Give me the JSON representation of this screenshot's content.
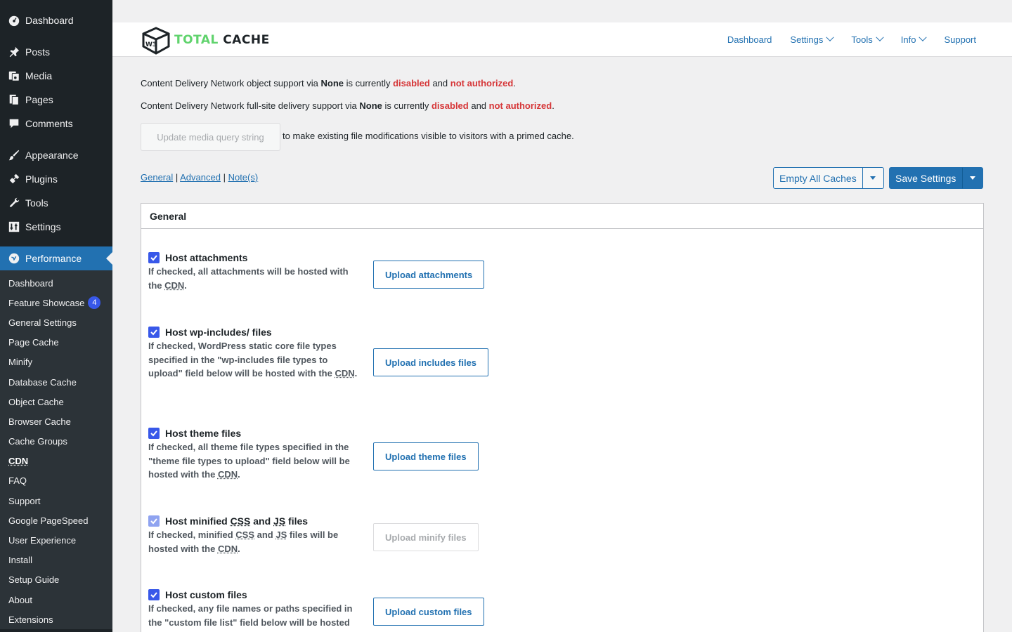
{
  "sidebar": {
    "top_items": [
      {
        "label": "Dashboard",
        "icon": "dashboard-icon"
      },
      {
        "label": "Posts",
        "icon": "pushpin-icon"
      },
      {
        "label": "Media",
        "icon": "media-icon"
      },
      {
        "label": "Pages",
        "icon": "pages-icon"
      },
      {
        "label": "Comments",
        "icon": "comment-icon"
      },
      {
        "label": "Appearance",
        "icon": "paintbrush-icon"
      },
      {
        "label": "Plugins",
        "icon": "plugin-icon"
      },
      {
        "label": "Tools",
        "icon": "wrench-icon"
      },
      {
        "label": "Settings",
        "icon": "settings-icon"
      },
      {
        "label": "Performance",
        "icon": "performance-icon"
      }
    ],
    "submenu": [
      "Dashboard",
      "Feature Showcase",
      "General Settings",
      "Page Cache",
      "Minify",
      "Database Cache",
      "Object Cache",
      "Browser Cache",
      "Cache Groups",
      "CDN",
      "FAQ",
      "Support",
      "Google PageSpeed",
      "User Experience",
      "Install",
      "Setup Guide",
      "About",
      "Extensions"
    ],
    "feature_showcase_badge": "4"
  },
  "header": {
    "logo_total": "TOTAL",
    "logo_cache": "CACHE",
    "logo_mark": "W3",
    "nav": [
      "Dashboard",
      "Settings",
      "Tools",
      "Info",
      "Support"
    ]
  },
  "notices": {
    "n1_pre": "Content Delivery Network object support via ",
    "n1_provider": "None",
    "n1_mid": " is currently ",
    "n1_disabled": "disabled",
    "n1_and": " and ",
    "n1_not_auth": "not authorized",
    "n1_end": ".",
    "n2_pre": "Content Delivery Network full-site delivery support via ",
    "n2_provider": "None",
    "n2_mid": " is currently ",
    "n2_disabled": "disabled",
    "n2_and": " and ",
    "n2_not_auth": "not authorized",
    "n2_end": ".",
    "update_btn": "Update media query string",
    "update_suffix": "to make existing file modifications visible to visitors with a primed cache."
  },
  "tabs": {
    "general": "General",
    "sep": " | ",
    "advanced": "Advanced",
    "notes": "Note(s)"
  },
  "actions": {
    "empty_caches": "Empty All Caches",
    "save_settings": "Save Settings"
  },
  "panel": {
    "title": "General",
    "options": [
      {
        "title": "Host attachments",
        "desc_pre": "If checked, all attachments will be hosted with the ",
        "desc_abbr": "CDN",
        "desc_end": ".",
        "button": "Upload attachments"
      },
      {
        "title": "Host wp-includes/ files",
        "desc_pre": "If checked, WordPress static core file types specified in the \"wp-includes file types to upload\" field below will be hosted with the ",
        "desc_abbr": "CDN",
        "desc_end": ".",
        "button": "Upload includes files"
      },
      {
        "title": "Host theme files",
        "desc_pre": "If checked, all theme file types specified in the \"theme file types to upload\" field below will be hosted with the ",
        "desc_abbr": "CDN",
        "desc_end": ".",
        "button": "Upload theme files"
      },
      {
        "title_pre": "Host minified ",
        "title_css": "CSS",
        "title_and": " and ",
        "title_js": "JS",
        "title_end": " files",
        "desc_pre": "If checked, minified ",
        "desc_css": "CSS",
        "desc_and": " and ",
        "desc_js": "JS",
        "desc_mid": " files will be hosted with the ",
        "desc_abbr": "CDN",
        "desc_end": ".",
        "button": "Upload minify files"
      },
      {
        "title": "Host custom files",
        "desc_pre": "If checked, any file names or paths specified in the \"custom file list\" field below will be hosted",
        "button": "Upload custom files"
      }
    ]
  }
}
